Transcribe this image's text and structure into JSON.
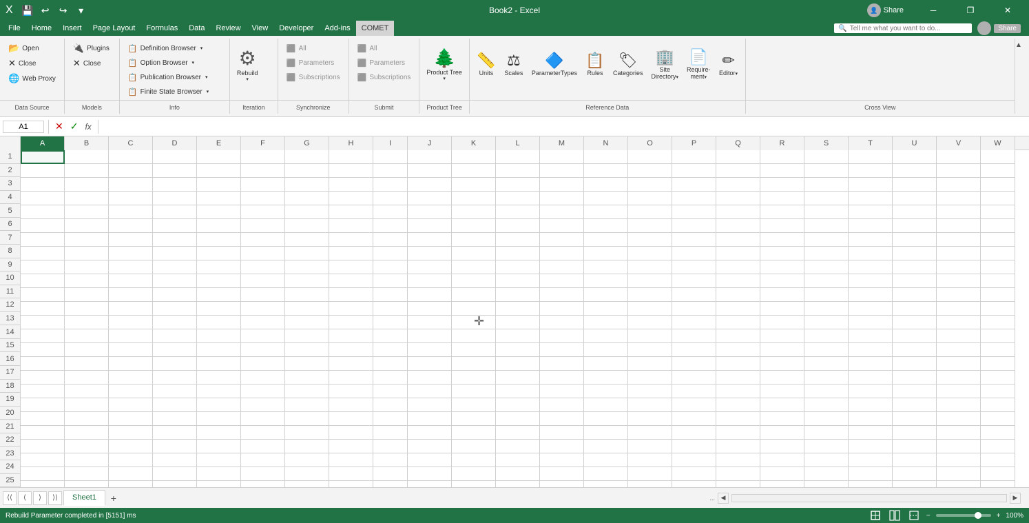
{
  "titlebar": {
    "title": "Book2 - Excel",
    "save_label": "💾",
    "undo_label": "↩",
    "redo_label": "↪",
    "customize_label": "▾",
    "minimize": "─",
    "restore": "❐",
    "close": "✕"
  },
  "menubar": {
    "items": [
      "File",
      "Home",
      "Insert",
      "Page Layout",
      "Formulas",
      "Data",
      "Review",
      "View",
      "Developer",
      "Add-ins",
      "COMET"
    ]
  },
  "searchbar": {
    "placeholder": "Tell me what you want to do..."
  },
  "ribbon": {
    "groups": {
      "datasource": {
        "label": "Data Source",
        "open": "Open",
        "close_top": "Close",
        "webproxy": "Web Proxy"
      },
      "models": {
        "label": "Models",
        "plugins": "Plugins",
        "close": "Close"
      },
      "info": {
        "label": "Info",
        "definition_browser": "Definition Browser",
        "option_browser": "Option Browser",
        "publication_browser": "Publication Browser",
        "finite_state_browser": "Finite State Browser"
      },
      "iteration": {
        "label": "Iteration",
        "rebuild": "Rebuild"
      },
      "synchronize": {
        "label": "Synchronize",
        "all": "All",
        "parameters": "Parameters",
        "subscriptions": "Subscriptions"
      },
      "submit": {
        "label": "Submit",
        "all": "All",
        "parameters": "Parameters",
        "subscriptions": "Subscriptions"
      },
      "product_tree": {
        "label": "Product Tree",
        "product_tree": "Product Tree"
      },
      "reference_data": {
        "label": "Reference Data",
        "units": "Units",
        "scales": "Scales",
        "parameter_types": "ParameterTypes",
        "rules": "Rules",
        "categories": "Categories",
        "site_directory": "Site Directory",
        "requirement": "Requirement",
        "editor": "Editor"
      },
      "cross_view": {
        "label": "Cross View"
      }
    }
  },
  "formula_bar": {
    "cell_ref": "A1",
    "formula_value": ""
  },
  "spreadsheet": {
    "columns": [
      "A",
      "B",
      "C",
      "D",
      "E",
      "F",
      "G",
      "H",
      "I",
      "J",
      "K",
      "L",
      "M",
      "N",
      "O",
      "P",
      "Q",
      "R",
      "S",
      "T",
      "U",
      "V",
      "W"
    ],
    "rows": [
      "1",
      "2",
      "3",
      "4",
      "5",
      "6",
      "7",
      "8",
      "9",
      "10",
      "11",
      "12",
      "13",
      "14",
      "15",
      "16",
      "17",
      "18",
      "19",
      "20",
      "21",
      "22",
      "23",
      "24",
      "25"
    ],
    "selected_cell": "A1"
  },
  "sheet_tabs": {
    "tabs": [
      "Sheet1"
    ],
    "active": "Sheet1",
    "add_label": "+"
  },
  "status_bar": {
    "message": "Rebuild Parameter completed in [5151] ms",
    "zoom": "100%",
    "zoom_value": 100
  }
}
